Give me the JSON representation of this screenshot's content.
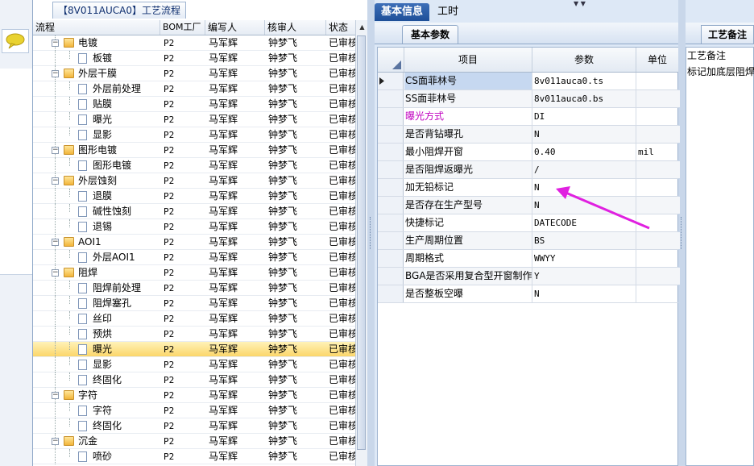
{
  "colors": {
    "accent": "#1e4f98",
    "selection": "#fbd66a",
    "highlight_text": "#c000c0",
    "arrow": "#e020e0"
  },
  "tree": {
    "title": "【8V011AUCA0】工艺流程",
    "columns": [
      "流程",
      "BOM工厂",
      "编写人",
      "核审人",
      "状态"
    ],
    "rows": [
      {
        "label": "电镀",
        "type": "folder",
        "bom": "P2",
        "author": "马军辉",
        "reviewer": "钟梦飞",
        "status": "已审核"
      },
      {
        "label": "板镀",
        "type": "doc",
        "bom": "P2",
        "author": "马军辉",
        "reviewer": "钟梦飞",
        "status": "已审核"
      },
      {
        "label": "外层干膜",
        "type": "folder",
        "bom": "P2",
        "author": "马军辉",
        "reviewer": "钟梦飞",
        "status": "已审核"
      },
      {
        "label": "外层前处理",
        "type": "doc",
        "bom": "P2",
        "author": "马军辉",
        "reviewer": "钟梦飞",
        "status": "已审核"
      },
      {
        "label": "贴膜",
        "type": "doc",
        "bom": "P2",
        "author": "马军辉",
        "reviewer": "钟梦飞",
        "status": "已审核"
      },
      {
        "label": "曝光",
        "type": "doc",
        "bom": "P2",
        "author": "马军辉",
        "reviewer": "钟梦飞",
        "status": "已审核"
      },
      {
        "label": "显影",
        "type": "doc",
        "bom": "P2",
        "author": "马军辉",
        "reviewer": "钟梦飞",
        "status": "已审核"
      },
      {
        "label": "图形电镀",
        "type": "folder",
        "bom": "P2",
        "author": "马军辉",
        "reviewer": "钟梦飞",
        "status": "已审核"
      },
      {
        "label": "图形电镀",
        "type": "doc",
        "bom": "P2",
        "author": "马军辉",
        "reviewer": "钟梦飞",
        "status": "已审核"
      },
      {
        "label": "外层蚀刻",
        "type": "folder",
        "bom": "P2",
        "author": "马军辉",
        "reviewer": "钟梦飞",
        "status": "已审核"
      },
      {
        "label": "退膜",
        "type": "doc",
        "bom": "P2",
        "author": "马军辉",
        "reviewer": "钟梦飞",
        "status": "已审核"
      },
      {
        "label": "碱性蚀刻",
        "type": "doc",
        "bom": "P2",
        "author": "马军辉",
        "reviewer": "钟梦飞",
        "status": "已审核"
      },
      {
        "label": "退锡",
        "type": "doc",
        "bom": "P2",
        "author": "马军辉",
        "reviewer": "钟梦飞",
        "status": "已审核"
      },
      {
        "label": "AOI1",
        "type": "folder",
        "bom": "P2",
        "author": "马军辉",
        "reviewer": "钟梦飞",
        "status": "已审核"
      },
      {
        "label": "外层AOI1",
        "type": "doc",
        "bom": "P2",
        "author": "马军辉",
        "reviewer": "钟梦飞",
        "status": "已审核"
      },
      {
        "label": "阻焊",
        "type": "folder",
        "bom": "P2",
        "author": "马军辉",
        "reviewer": "钟梦飞",
        "status": "已审核"
      },
      {
        "label": "阻焊前处理",
        "type": "doc",
        "bom": "P2",
        "author": "马军辉",
        "reviewer": "钟梦飞",
        "status": "已审核"
      },
      {
        "label": "阻焊塞孔",
        "type": "doc",
        "bom": "P2",
        "author": "马军辉",
        "reviewer": "钟梦飞",
        "status": "已审核"
      },
      {
        "label": "丝印",
        "type": "doc",
        "bom": "P2",
        "author": "马军辉",
        "reviewer": "钟梦飞",
        "status": "已审核"
      },
      {
        "label": "预烘",
        "type": "doc",
        "bom": "P2",
        "author": "马军辉",
        "reviewer": "钟梦飞",
        "status": "已审核"
      },
      {
        "label": "曝光",
        "type": "doc",
        "bom": "P2",
        "author": "马军辉",
        "reviewer": "钟梦飞",
        "status": "已审核",
        "selected": true
      },
      {
        "label": "显影",
        "type": "doc",
        "bom": "P2",
        "author": "马军辉",
        "reviewer": "钟梦飞",
        "status": "已审核"
      },
      {
        "label": "终固化",
        "type": "doc",
        "bom": "P2",
        "author": "马军辉",
        "reviewer": "钟梦飞",
        "status": "已审核"
      },
      {
        "label": "字符",
        "type": "folder",
        "bom": "P2",
        "author": "马军辉",
        "reviewer": "钟梦飞",
        "status": "已审核"
      },
      {
        "label": "字符",
        "type": "doc",
        "bom": "P2",
        "author": "马军辉",
        "reviewer": "钟梦飞",
        "status": "已审核"
      },
      {
        "label": "终固化",
        "type": "doc",
        "bom": "P2",
        "author": "马军辉",
        "reviewer": "钟梦飞",
        "status": "已审核"
      },
      {
        "label": "沉金",
        "type": "folder",
        "bom": "P2",
        "author": "马军辉",
        "reviewer": "钟梦飞",
        "status": "已审核"
      },
      {
        "label": "喷砂",
        "type": "doc",
        "bom": "P2",
        "author": "马军辉",
        "reviewer": "钟梦飞",
        "status": "已审核"
      }
    ]
  },
  "middle": {
    "tabs": [
      "基本信息",
      "工时"
    ],
    "subtab": "基本参数",
    "columns": [
      "项目",
      "参数",
      "单位"
    ],
    "rows": [
      {
        "name": "CS面菲林号",
        "value": "8v011auca0.ts",
        "unit": "",
        "current": true,
        "highlight": true
      },
      {
        "name": "SS面菲林号",
        "value": "8v011auca0.bs",
        "unit": ""
      },
      {
        "name": "曝光方式",
        "value": "DI",
        "unit": "",
        "pink": true
      },
      {
        "name": "是否背钻曝孔",
        "value": "N",
        "unit": ""
      },
      {
        "name": "最小阻焊开窗",
        "value": "0.40",
        "unit": "mil"
      },
      {
        "name": "是否阻焊返曝光",
        "value": "/",
        "unit": ""
      },
      {
        "name": "加无铅标记",
        "value": "N",
        "unit": ""
      },
      {
        "name": "是否存在生产型号",
        "value": "N",
        "unit": ""
      },
      {
        "name": "快捷标记",
        "value": "DATECODE",
        "unit": ""
      },
      {
        "name": "生产周期位置",
        "value": "BS",
        "unit": ""
      },
      {
        "name": "周期格式",
        "value": "WWYY",
        "unit": ""
      },
      {
        "name": "BGA是否采用复合型开窗制作",
        "value": "Y",
        "unit": ""
      },
      {
        "name": "是否整板空曝",
        "value": "N",
        "unit": ""
      }
    ]
  },
  "right": {
    "tab": "工艺备注",
    "header": "工艺备注",
    "text": "标记加底层阻焊"
  }
}
